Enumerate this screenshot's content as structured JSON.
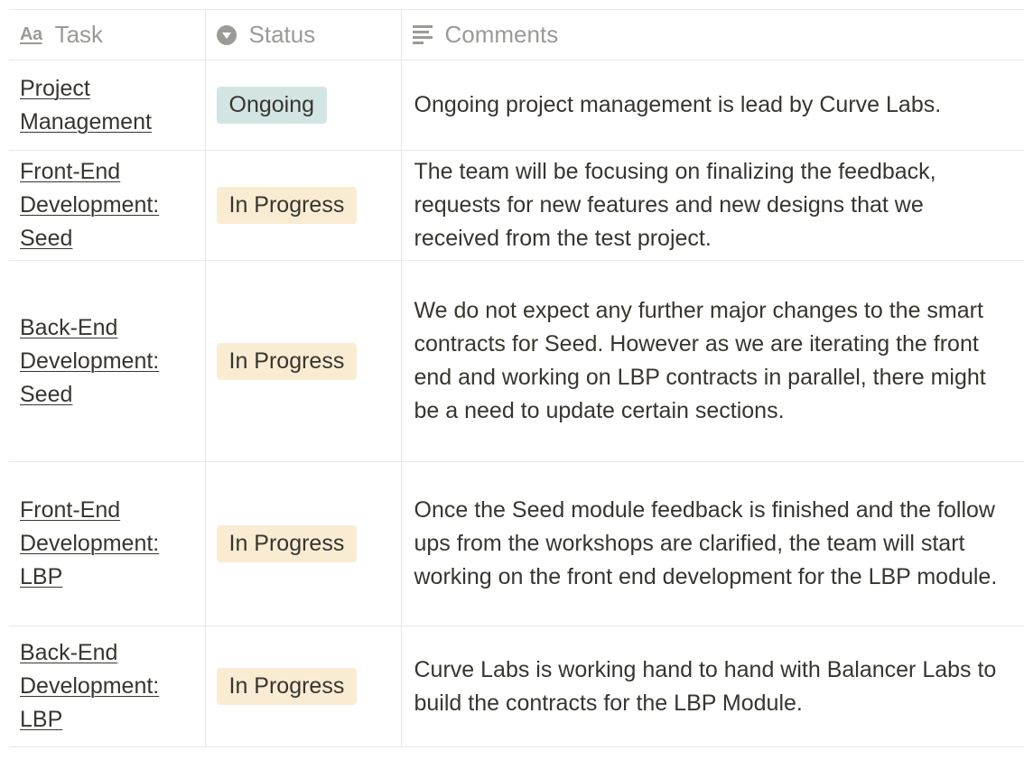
{
  "table": {
    "headers": {
      "task": {
        "label": "Task",
        "icon": "text-property-icon",
        "icon_glyph": "Aa"
      },
      "status": {
        "label": "Status",
        "icon": "select-property-icon"
      },
      "comments": {
        "label": "Comments",
        "icon": "text-lines-icon"
      }
    },
    "rows": [
      {
        "task": "Project Management",
        "status": "Ongoing",
        "status_color": "#d3e5e3",
        "comment": "Ongoing project management is lead by Curve Labs."
      },
      {
        "task": "Front-End Development: Seed",
        "status": "In Progress",
        "status_color": "#f9ecd3",
        "comment": "The team will be focusing on finalizing the feedback, requests for new features and new designs that we received from the test project."
      },
      {
        "task": "Back-End Development: Seed",
        "status": "In Progress",
        "status_color": "#f9ecd3",
        "comment": "We do not expect any further major changes to the smart contracts for Seed. However as we are iterating the front end and working on LBP contracts in parallel, there might be a need to update certain sections."
      },
      {
        "task": "Front-End Development: LBP",
        "status": "In Progress",
        "status_color": "#f9ecd3",
        "comment": "Once the Seed module feedback is finished and the follow ups from the workshops are clarified, the team will start working on the front end development for the LBP module."
      },
      {
        "task": "Back-End Development: LBP",
        "status": "In Progress",
        "status_color": "#f9ecd3",
        "comment": "Curve Labs is working hand to hand with Balancer Labs to build the contracts for the LBP Module."
      }
    ]
  },
  "colors": {
    "border": "#e9e9e7",
    "header_text": "#9b9a97",
    "body_text": "#37352f",
    "ongoing_badge": "#d3e5e3",
    "in_progress_badge": "#f9ecd3"
  }
}
